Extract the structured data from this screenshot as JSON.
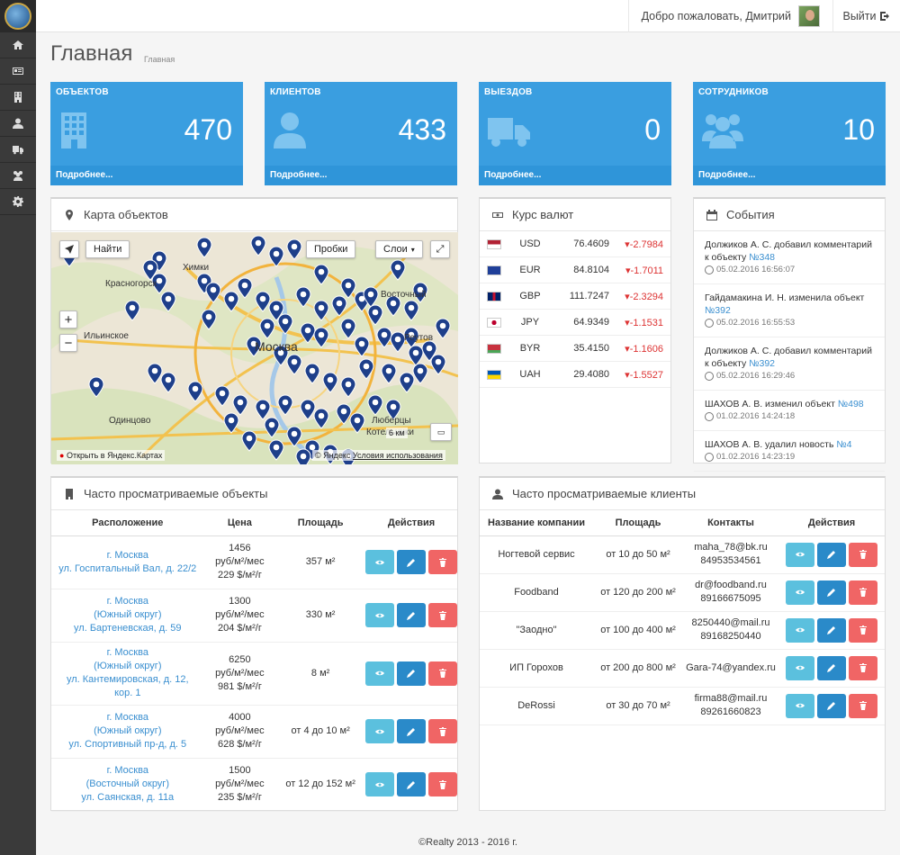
{
  "sidebar": {
    "items": [
      "home",
      "id-card",
      "building",
      "user",
      "truck",
      "users",
      "gear"
    ]
  },
  "topbar": {
    "welcome": "Добро пожаловать, Дмитрий",
    "logout": "Выйти"
  },
  "page": {
    "title": "Главная",
    "breadcrumb": "Главная"
  },
  "stats": [
    {
      "label": "ОБЪЕКТОВ",
      "value": "470",
      "more": "Подробнее...",
      "icon": "building-icon"
    },
    {
      "label": "КЛИЕНТОВ",
      "value": "433",
      "more": "Подробнее...",
      "icon": "user-icon"
    },
    {
      "label": "ВЫЕЗДОВ",
      "value": "0",
      "more": "Подробнее...",
      "icon": "truck-icon"
    },
    {
      "label": "СОТРУДНИКОВ",
      "value": "10",
      "more": "Подробнее...",
      "icon": "users-icon"
    }
  ],
  "map": {
    "title": "Карта объектов",
    "find": "Найти",
    "traffic": "Пробки",
    "layers": "Слои",
    "open_yandex": "Открыть в Яндекс.Картах",
    "copyright": "© Яндекс",
    "terms": "Условия использования",
    "scale": "6 км",
    "places": [
      "Красногорск",
      "Москва",
      "Одинцово",
      "Люберцы",
      "Котельники",
      "Реутов",
      "Ильинское",
      "Восточный",
      "Химки"
    ]
  },
  "currency": {
    "title": "Курс валют",
    "rows": [
      {
        "code": "USD",
        "rate": "76.4609",
        "change": "-2.7984"
      },
      {
        "code": "EUR",
        "rate": "84.8104",
        "change": "-1.7011"
      },
      {
        "code": "GBP",
        "rate": "111.7247",
        "change": "-2.3294"
      },
      {
        "code": "JPY",
        "rate": "64.9349",
        "change": "-1.1531"
      },
      {
        "code": "BYR",
        "rate": "35.4150",
        "change": "-1.1606"
      },
      {
        "code": "UAH",
        "rate": "29.4080",
        "change": "-1.5527"
      }
    ]
  },
  "events": {
    "title": "События",
    "items": [
      {
        "text": "Должиков А. С. добавил комментарий к объекту ",
        "link": "№348",
        "time": "05.02.2016 16:56:07"
      },
      {
        "text": "Гайдамакина И. Н. изменила объект ",
        "link": "№392",
        "time": "05.02.2016 16:55:53"
      },
      {
        "text": "Должиков А. С. добавил комментарий к объекту ",
        "link": "№392",
        "time": "05.02.2016 16:29:46"
      },
      {
        "text": "ШАХОВ А. В. изменил объект ",
        "link": "№498",
        "time": "01.02.2016 14:24:18"
      },
      {
        "text": "ШАХОВ А. В. удалил новость ",
        "link": "№4",
        "time": "01.02.2016 14:23:19"
      }
    ]
  },
  "objects": {
    "title": "Часто просматриваемые объекты",
    "headers": [
      "Расположение",
      "Цена",
      "Площадь",
      "Действия"
    ],
    "rows": [
      {
        "loc": [
          "г. Москва",
          "ул. Госпитальный Вал, д. 22/2"
        ],
        "price": [
          "1456",
          "руб/м²/мес",
          "229 $/м²/г"
        ],
        "area": "357 м²"
      },
      {
        "loc": [
          "г. Москва",
          "(Южный округ)",
          "ул. Бартеневская, д. 59"
        ],
        "price": [
          "1300",
          "руб/м²/мес",
          "204 $/м²/г"
        ],
        "area": "330 м²"
      },
      {
        "loc": [
          "г. Москва",
          "(Южный округ)",
          "ул. Кантемировская, д. 12,",
          "кор. 1"
        ],
        "price": [
          "6250",
          "руб/м²/мес",
          "981 $/м²/г"
        ],
        "area": "8 м²"
      },
      {
        "loc": [
          "г. Москва",
          "(Южный округ)",
          "ул. Спортивный пр-д, д. 5"
        ],
        "price": [
          "4000",
          "руб/м²/мес",
          "628 $/м²/г"
        ],
        "area": "от 4 до 10 м²"
      },
      {
        "loc": [
          "г. Москва",
          "(Восточный округ)",
          "ул. Саянская, д. 11а"
        ],
        "price": [
          "1500",
          "руб/м²/мес",
          "235 $/м²/г"
        ],
        "area": "от 12 до 152 м²"
      }
    ]
  },
  "clients": {
    "title": "Часто просматриваемые клиенты",
    "headers": [
      "Название компании",
      "Площадь",
      "Контакты",
      "Действия"
    ],
    "rows": [
      {
        "name": "Ногтевой сервис",
        "area": "от 10 до 50 м²",
        "email": "maha_78@bk.ru",
        "phone": "84953534561"
      },
      {
        "name": "Foodband",
        "area": "от 120 до 200 м²",
        "email": "dr@foodband.ru",
        "phone": "89166675095"
      },
      {
        "name": "\"Заодно\"",
        "area": "от 100 до 400 м²",
        "email": "8250440@mail.ru",
        "phone": "89168250440"
      },
      {
        "name": "ИП Горохов",
        "area": "от 200 до 800 м²",
        "email": "Gara-74@yandex.ru",
        "phone": ""
      },
      {
        "name": "DeRossi",
        "area": "от 30 до 70 м²",
        "email": "firma88@mail.ru",
        "phone": "89261660823"
      }
    ]
  },
  "footer": "©Realty 2013 - 2016 г."
}
